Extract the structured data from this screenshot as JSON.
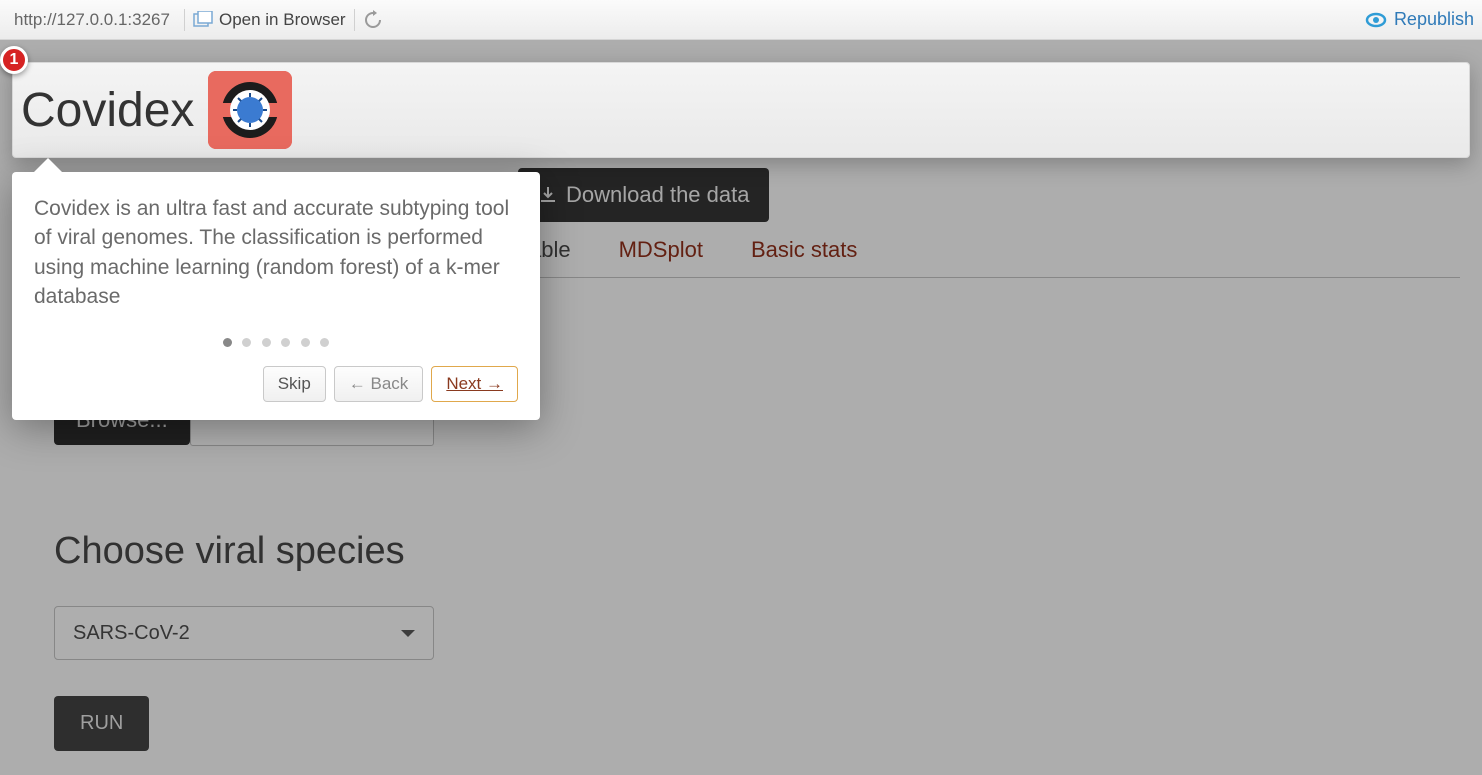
{
  "browser": {
    "url": "http://127.0.0.1:3267",
    "open_label": "Open in Browser",
    "republish_label": "Republish"
  },
  "badge": {
    "value": "1"
  },
  "header": {
    "title": "Covidex"
  },
  "tour": {
    "text": "Covidex is an ultra fast and accurate subtyping tool of viral genomes. The classification is performed using machine learning (random forest) of a k-mer database",
    "skip_label": "Skip",
    "back_label": "← Back",
    "next_label": "Next →",
    "step_count": 6,
    "step_active": 1
  },
  "toolbar": {
    "download_label": "Download the data"
  },
  "tabs": {
    "items": [
      {
        "label": "Table",
        "active": true
      },
      {
        "label": "MDSplot",
        "active": false
      },
      {
        "label": "Basic stats",
        "active": false
      }
    ]
  },
  "sidebar": {
    "browse_label": "Browse...",
    "species_heading": "Choose viral species",
    "species_selected": "SARS-CoV-2",
    "run_label": "RUN"
  }
}
